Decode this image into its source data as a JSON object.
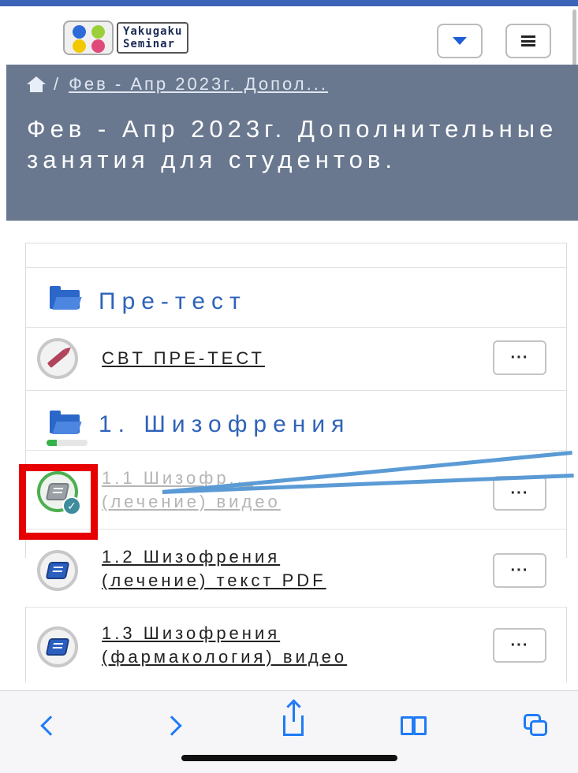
{
  "brand": {
    "line1": "Yakugaku",
    "line2": "Seminar",
    "dot_colors": [
      "#2f6ad9",
      "#f2c800",
      "#9bcf3a",
      "#e04a7a"
    ]
  },
  "nav": {
    "dropdown_icon": "caret-down-icon",
    "menu_icon": "hamburger-icon"
  },
  "breadcrumb": {
    "home_icon": "home-icon",
    "separator": "/",
    "current": "Фев - Апр 2023г. Допол..."
  },
  "page": {
    "title": "Фев - Апр 2023г. Дополнительные занятия для студентов."
  },
  "sections": [
    {
      "title": "Пре-тест",
      "progress_percent": 0,
      "activities": [
        {
          "title": "CBT ПРЕ-ТЕСТ",
          "icon": "pencil-icon",
          "completed": false,
          "more_label": "···"
        }
      ]
    },
    {
      "title": "1. Шизофрения",
      "progress_percent": 25,
      "activities": [
        {
          "title_line1": "1.1 Шизофр...",
          "title_line2": "(лечение) видео",
          "icon": "book-icon",
          "completed": true,
          "more_label": "···"
        },
        {
          "title_line1": "1.2 Шизофрения",
          "title_line2": "(лечение) текст PDF",
          "icon": "book-icon",
          "completed": false,
          "more_label": "···"
        },
        {
          "title_line1": "1.3 Шизофрения",
          "title_line2": "(фармакология) видео",
          "icon": "book-icon",
          "completed": false,
          "more_label": "···"
        }
      ]
    }
  ],
  "browser_toolbar": {
    "items": [
      "back-icon",
      "forward-icon",
      "share-icon",
      "bookmarks-icon",
      "tabs-icon"
    ]
  },
  "colors": {
    "accent": "#2e63b8",
    "hero_bg": "#69788f",
    "complete_green": "#4caf50",
    "annotation_red": "#e60000",
    "annotation_arrow": "#5b9bd5"
  }
}
